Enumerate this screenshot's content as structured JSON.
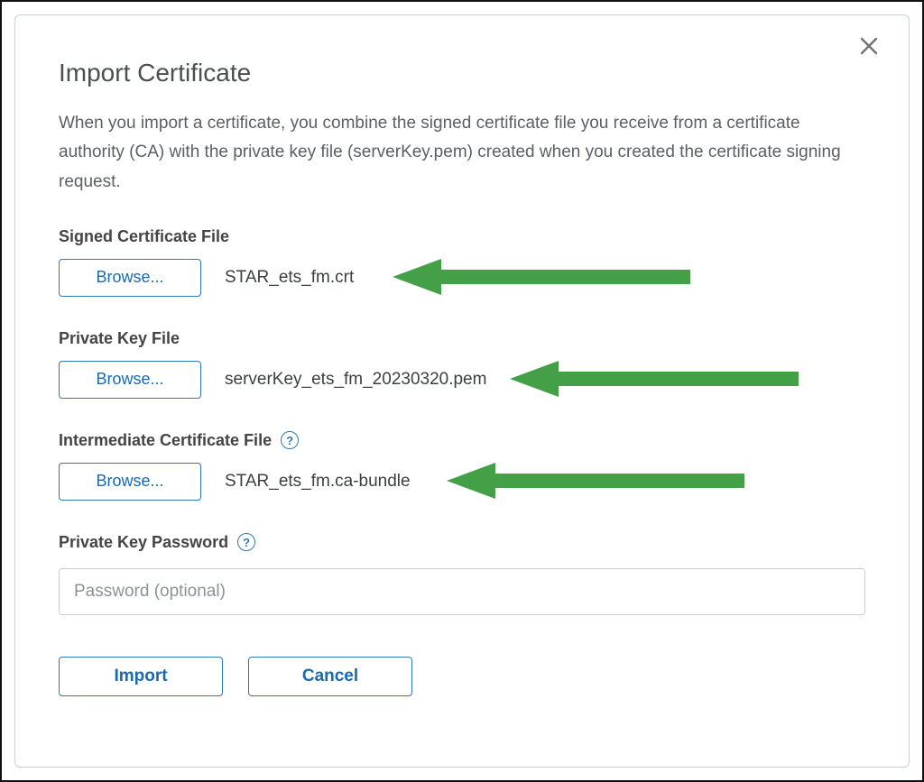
{
  "dialog": {
    "title": "Import Certificate",
    "description": "When you import a certificate, you combine the signed certificate file you receive from a certificate authority (CA) with the private key file (serverKey.pem) created when you created the certificate signing request."
  },
  "fields": {
    "signed_cert": {
      "label": "Signed Certificate File",
      "browse_label": "Browse...",
      "filename": "STAR_ets_fm.crt"
    },
    "private_key": {
      "label": "Private Key File",
      "browse_label": "Browse...",
      "filename": "serverKey_ets_fm_20230320.pem"
    },
    "intermediate": {
      "label": "Intermediate Certificate File",
      "browse_label": "Browse...",
      "filename": "STAR_ets_fm.ca-bundle"
    },
    "password": {
      "label": "Private Key Password",
      "placeholder": "Password (optional)",
      "value": ""
    }
  },
  "actions": {
    "import_label": "Import",
    "cancel_label": "Cancel"
  },
  "icons": {
    "help_glyph": "?"
  },
  "annotation": {
    "arrow_color": "#43a047"
  }
}
